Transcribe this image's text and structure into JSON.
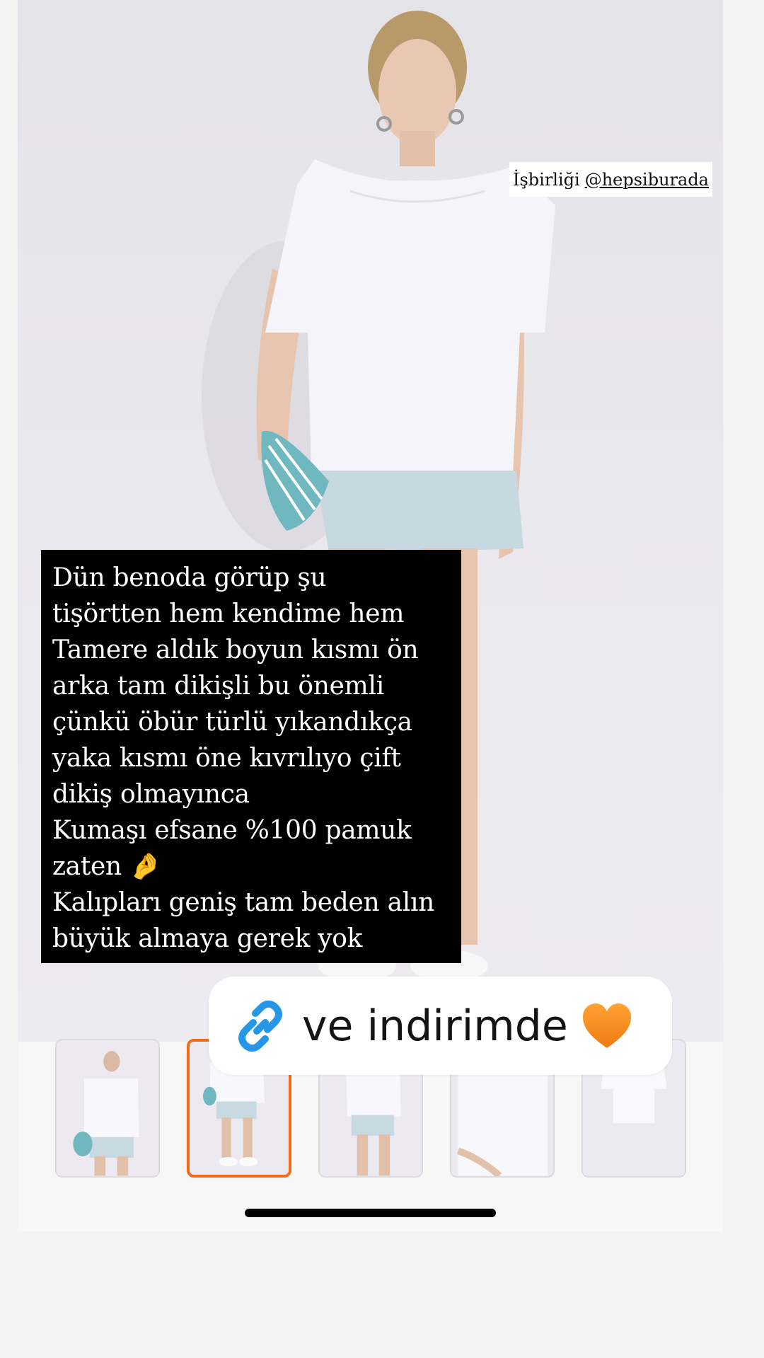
{
  "collab_sticker": {
    "prefix": "İşbirliği",
    "handle": "@hepsiburada"
  },
  "caption": {
    "lines": [
      "Dün benoda görüp şu",
      "tişörtten hem kendime hem",
      "Tamere aldık boyun kısmı ön",
      "arka tam dikişli bu önemli",
      "çünkü öbür türlü yıkandıkça",
      "yaka kısmı öne kıvrılıyo çift",
      "dikiş olmayınca",
      "Kumaşı efsane %100 pamuk",
      "zaten 🤌",
      "Kalıpları geniş tam beden alın",
      "büyük almaya gerek yok"
    ]
  },
  "link_sticker": {
    "icon": "link-icon",
    "text": "ve indirimde",
    "emoji": "orange-heart-icon"
  },
  "thumbnails": {
    "count": 5,
    "selected_index": 1,
    "accent_color": "#f26a18"
  }
}
